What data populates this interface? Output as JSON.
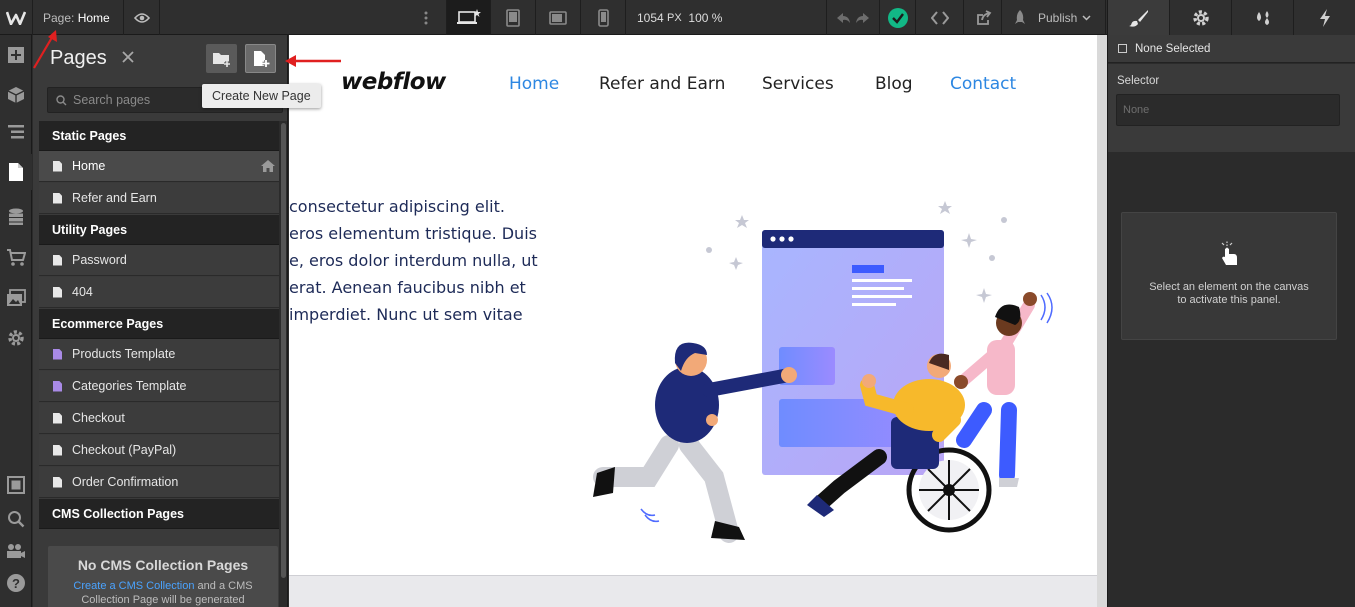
{
  "topbar": {
    "page_prefix": "Page:",
    "page_name": "Home",
    "width_value": "1054",
    "width_unit": "PX",
    "zoom": "100 %",
    "publish_label": "Publish",
    "icons": [
      "webflow-logo-icon",
      "eye-icon",
      "more-icon",
      "desktop-icon",
      "tablet-icon",
      "tablet-landscape-icon",
      "phone-icon",
      "undo-icon",
      "redo-icon",
      "check-icon",
      "code-icon",
      "export-icon",
      "rocket-icon",
      "chevron-down-icon"
    ]
  },
  "rail": {
    "icons": [
      "add-icon",
      "cube-icon",
      "navigator-icon",
      "pages-icon",
      "cms-icon",
      "ecommerce-icon",
      "assets-icon",
      "settings-icon",
      "box-icon",
      "search-icon",
      "video-icon",
      "help-icon"
    ]
  },
  "pages_panel": {
    "title": "Pages",
    "search_placeholder": "Search pages",
    "tooltip": "Create New Page",
    "sections": [
      {
        "title": "Static Pages",
        "items": [
          {
            "label": "Home",
            "type": "static",
            "active": true
          },
          {
            "label": "Refer and Earn",
            "type": "static"
          }
        ]
      },
      {
        "title": "Utility Pages",
        "items": [
          {
            "label": "Password",
            "type": "static"
          },
          {
            "label": "404",
            "type": "static"
          }
        ]
      },
      {
        "title": "Ecommerce Pages",
        "items": [
          {
            "label": "Products Template",
            "type": "template"
          },
          {
            "label": "Categories Template",
            "type": "template"
          },
          {
            "label": "Checkout",
            "type": "static"
          },
          {
            "label": "Checkout (PayPal)",
            "type": "static"
          },
          {
            "label": "Order Confirmation",
            "type": "static"
          }
        ]
      },
      {
        "title": "CMS Collection Pages",
        "items": []
      }
    ],
    "cms_empty": {
      "title": "No CMS Collection Pages",
      "link": "Create a CMS Collection",
      "rest_1": " and a CMS",
      "rest_2": "Collection Page will be generated"
    }
  },
  "canvas": {
    "brand": "webflow",
    "nav": [
      "Home",
      "Refer and Earn",
      "Services",
      "Blog",
      "Contact"
    ],
    "hero_lines": [
      "consectetur adipiscing elit.",
      "eros elementum tristique. Duis",
      "e, eros dolor interdum nulla, ut",
      "erat. Aenean faucibus nibh et",
      " imperdiet. Nunc ut sem vitae"
    ]
  },
  "right_panel": {
    "none_selected": "None Selected",
    "selector_label": "Selector",
    "selector_placeholder": "None",
    "empty_line_1": "Select an element on the canvas",
    "empty_line_2": "to activate this panel."
  },
  "colors": {
    "accent": "#2d87e2",
    "nav_text": "#222222",
    "hero_text": "#1d2a57",
    "arrow": "#e02020",
    "success": "#12b886"
  }
}
